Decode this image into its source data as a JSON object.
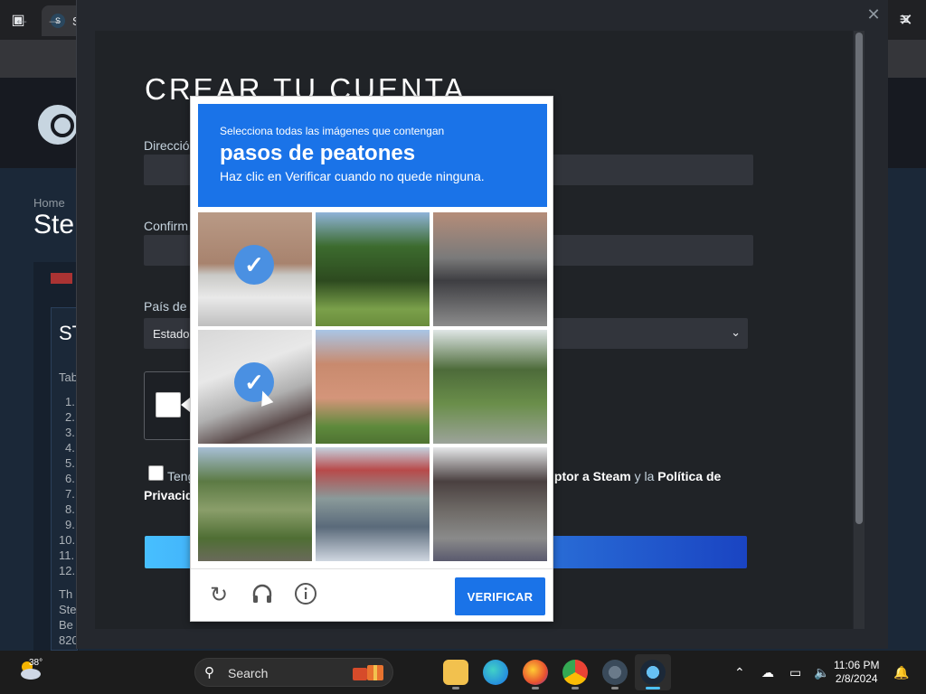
{
  "browser": {
    "tab_title": "S",
    "close_glyph": "✕",
    "back_glyph": "←",
    "forward_glyph": "→",
    "menu_glyph": "≡"
  },
  "steam_page": {
    "breadcrumb": "Home",
    "title": "Ste",
    "left_items": [
      "ST",
      "Tab",
      "1.",
      "2.",
      "3.",
      "4.",
      "5.",
      "6.",
      "7.",
      "8.",
      "9.",
      "10.",
      "11.",
      "12.",
      "Th",
      "Ste",
      "Be",
      "820"
    ]
  },
  "modal": {
    "close_glyph": "✕",
    "title": "CREAR TU CUENTA",
    "email_label": "Direcció",
    "confirm_label": "Confirm",
    "country_label": "País de",
    "country_value": "Estado",
    "agree_prefix": "Teng",
    "agree_right_a": "iptor a Steam",
    "agree_right_b": " y la ",
    "agree_right_c": "Política de",
    "agree_line2": "Privacid"
  },
  "captcha": {
    "instruction_small": "Selecciona todas las imágenes que contengan",
    "target": "pasos de peatones",
    "instruction_sub": "Haz clic en Verificar cuando no quede ninguna.",
    "verify_label": "VERIFICAR",
    "tiles": [
      {
        "name": "crosswalk-street",
        "selected": true
      },
      {
        "name": "garden-fence",
        "selected": false
      },
      {
        "name": "motorcycle-rider",
        "selected": false
      },
      {
        "name": "crosswalk-scooter",
        "selected": true
      },
      {
        "name": "house-balcony",
        "selected": false
      },
      {
        "name": "traffic-light-trees",
        "selected": false
      },
      {
        "name": "street-grass",
        "selected": false
      },
      {
        "name": "scooters-traffic",
        "selected": false
      },
      {
        "name": "alley-car",
        "selected": false
      }
    ],
    "icons": [
      "reload-icon",
      "headphones-icon",
      "info-icon"
    ],
    "colors": {
      "header": "#1a73e8",
      "check": "#4a90e2"
    }
  },
  "taskbar": {
    "temperature": "38°",
    "search_placeholder": "Search",
    "time": "11:06 PM",
    "date": "2/8/2024"
  }
}
